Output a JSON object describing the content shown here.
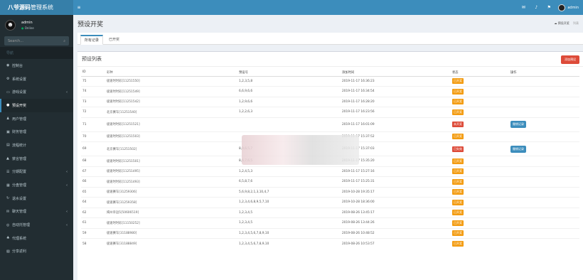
{
  "app": {
    "logo_main": "八爷源码",
    "logo_sub": "管理系统",
    "toggle_icon": "≡",
    "top_icons": [
      "mail-icon",
      "bell-icon",
      "flag-icon"
    ],
    "user_name": "admin"
  },
  "sidebar": {
    "user_name": "admin",
    "user_status": "Online",
    "search_placeholder": "Search...",
    "search_icon": "⌕",
    "nav_header": "导航",
    "items": [
      {
        "label": "控制台",
        "icon": "dashboard-icon",
        "glyph": "◉"
      },
      {
        "label": "系统设置",
        "icon": "settings-icon",
        "glyph": "⚙"
      },
      {
        "label": "游戏设置",
        "icon": "gamepad-icon",
        "glyph": "▭"
      },
      {
        "label": "预设开奖",
        "icon": "circle-icon",
        "glyph": "●"
      },
      {
        "label": "用户管理",
        "icon": "user-icon",
        "glyph": "♟"
      },
      {
        "label": "财务管理",
        "icon": "money-icon",
        "glyph": "▣"
      },
      {
        "label": "流程统计",
        "icon": "chart-icon",
        "glyph": "▤"
      },
      {
        "label": "禁言管理",
        "icon": "warning-icon",
        "glyph": "▲"
      },
      {
        "label": "分期配置",
        "icon": "list-icon",
        "glyph": "☰"
      },
      {
        "label": "分盘管理",
        "icon": "grid-icon",
        "glyph": "▦"
      },
      {
        "label": "退水设置",
        "icon": "refresh-icon",
        "glyph": "↻"
      },
      {
        "label": "聊天管理",
        "icon": "chat-icon",
        "glyph": "✉"
      },
      {
        "label": "自动托管理",
        "icon": "robot-icon",
        "glyph": "◎"
      },
      {
        "label": "代理系统",
        "icon": "agent-icon",
        "glyph": "♣"
      },
      {
        "label": "分享返利",
        "icon": "share-icon",
        "glyph": "▧"
      }
    ]
  },
  "header": {
    "title": "预设开奖",
    "breadcrumb_home": "预设开奖",
    "breadcrumb_current": "列表"
  },
  "tabs": [
    {
      "label": "所有记录"
    },
    {
      "label": "已开奖"
    }
  ],
  "box": {
    "title": "预设列表",
    "add_button": "添加预设"
  },
  "table": {
    "columns": [
      "ID",
      "彩种",
      "预设号",
      "添加时间",
      "状态",
      "操作"
    ],
    "rows": [
      {
        "id": "75",
        "type": "极速时时彩[11251550]",
        "num": "1,2,3,5,8",
        "time": "2019-11-17 16:36:23",
        "status": "已开奖",
        "op": ""
      },
      {
        "id": "74",
        "type": "极速时时彩[11251549]",
        "num": "6,6,9,6,6",
        "time": "2019-11-17 16:34:54",
        "status": "已开奖",
        "op": ""
      },
      {
        "id": "73",
        "type": "极速时时彩[11251542]",
        "num": "1,2,9,6,6",
        "time": "2019-11-17 16:28:20",
        "status": "已开奖",
        "op": ""
      },
      {
        "id": "72",
        "type": "北京赛车[11251540]",
        "num": "1,2,2,6,3",
        "time": "2019-11-17 16:23:56",
        "status": "已开奖",
        "op": ""
      },
      {
        "id": "71",
        "type": "极速时时彩[11251521]",
        "num": "",
        "time": "2019-11-17 16:01:09",
        "status": "未开奖",
        "op": "撤销记录",
        "tall": true
      },
      {
        "id": "70",
        "type": "极速时时彩[11251503]",
        "num": "",
        "time": "2019-11-17 15:37:52",
        "status": "已开奖",
        "op": ""
      },
      {
        "id": "69",
        "type": "北京赛车[11251502]",
        "num": "8,9,6,5,7",
        "time": "2019-11-17 15:37:03",
        "status": "已失效",
        "op": "撤销记录",
        "tall": true
      },
      {
        "id": "68",
        "type": "极速时时彩[11251501]",
        "num": "8,6,7,6,5",
        "time": "2019-11-17 15:35:20",
        "status": "已开奖",
        "op": ""
      },
      {
        "id": "67",
        "type": "极速时时彩[11251495]",
        "num": "1,2,4,5,3",
        "time": "2019-11-17 15:27:16",
        "status": "已开奖",
        "op": ""
      },
      {
        "id": "66",
        "type": "极速时时彩[11251493]",
        "num": "6,5,8,7,6",
        "time": "2019-11-17 15:25:31",
        "status": "已开奖",
        "op": ""
      },
      {
        "id": "65",
        "type": "极速赛车[31259306]",
        "num": "5,6,9,8,2,1,3,10,4,7",
        "time": "2019-10-28 19:35:17",
        "status": "已开奖",
        "op": ""
      },
      {
        "id": "64",
        "type": "极速赛车[31259358]",
        "num": "1,2,3,4,6,8,9,5,7,10",
        "time": "2019-10-28 18:36:00",
        "status": "已开奖",
        "op": ""
      },
      {
        "id": "62",
        "type": "揭州幸运5[50606519]",
        "num": "1,2,3,4,5",
        "time": "2019-08-26 13:45:17",
        "status": "已开奖",
        "op": ""
      },
      {
        "id": "61",
        "type": "极速时时彩[11150252]",
        "num": "1,2,3,4,5",
        "time": "2019-08-26 13:44:26",
        "status": "已开奖",
        "op": ""
      },
      {
        "id": "59",
        "type": "极速赛车[31188980]",
        "num": "1,2,3,4,5,6,7,8,9,10",
        "time": "2019-08-26 10:48:52",
        "status": "已开奖",
        "op": ""
      },
      {
        "id": "58",
        "type": "极速赛车[31188849]",
        "num": "1,2,3,4,5,6,7,8,9,10",
        "time": "2019-08-26 10:53:57",
        "status": "已开奖",
        "op": ""
      }
    ]
  },
  "colors": {
    "topbar": "#3c8dbc",
    "logo_bg": "#367fa9",
    "sidebar_bg": "#222d32",
    "badge_done": "#f39c12",
    "badge_red": "#dd4b39",
    "op_button": "#3c8dbc",
    "add_button": "#dd4b39"
  }
}
